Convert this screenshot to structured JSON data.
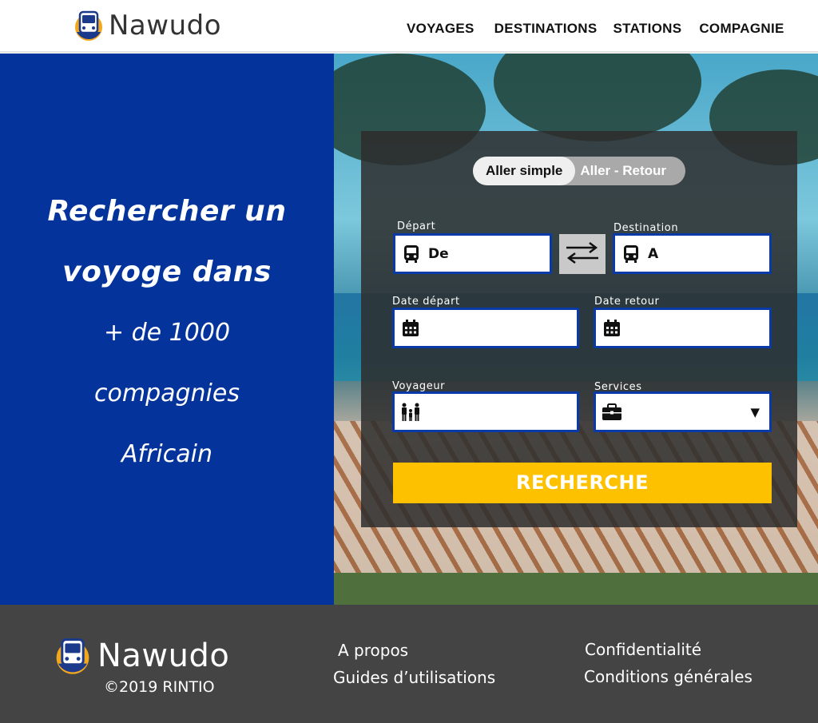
{
  "brand": {
    "name": "Nawudo"
  },
  "nav": {
    "items": [
      "VOYAGES",
      "DESTINATIONS",
      "STATIONS",
      "COMPAGNIE"
    ]
  },
  "hero": {
    "line1": "Rechercher un",
    "line2": "voyoge dans",
    "line3": "+ de 1000",
    "line4": "compagnies",
    "line5": "Africain"
  },
  "search": {
    "trip_types": [
      "Aller simple",
      "Aller - Retour"
    ],
    "active_trip": "Aller simple",
    "departure_label": "Départ",
    "departure_value": "De",
    "destination_label": "Destination",
    "destination_value": "A",
    "date_depart_label": "Date départ",
    "date_retour_label": "Date retour",
    "voyageur_label": "Voyageur",
    "services_label": "Services",
    "submit_label": "RECHERCHE"
  },
  "footer": {
    "brand": "Nawudo",
    "copyright": "©2019 RINTIO",
    "links_col1": [
      "A propos",
      "Guides d’utilisations"
    ],
    "links_col2": [
      "Confidentialité",
      "Conditions générales"
    ]
  },
  "colors": {
    "brand_blue": "#03339b",
    "accent_yellow": "#fdc100",
    "footer_bg": "#444444",
    "field_border": "#0a3aa8"
  },
  "icons": [
    "bus-logo-icon",
    "bus-icon",
    "swap-arrows-icon",
    "calendar-icon",
    "family-icon",
    "briefcase-icon",
    "dropdown-caret-icon"
  ]
}
